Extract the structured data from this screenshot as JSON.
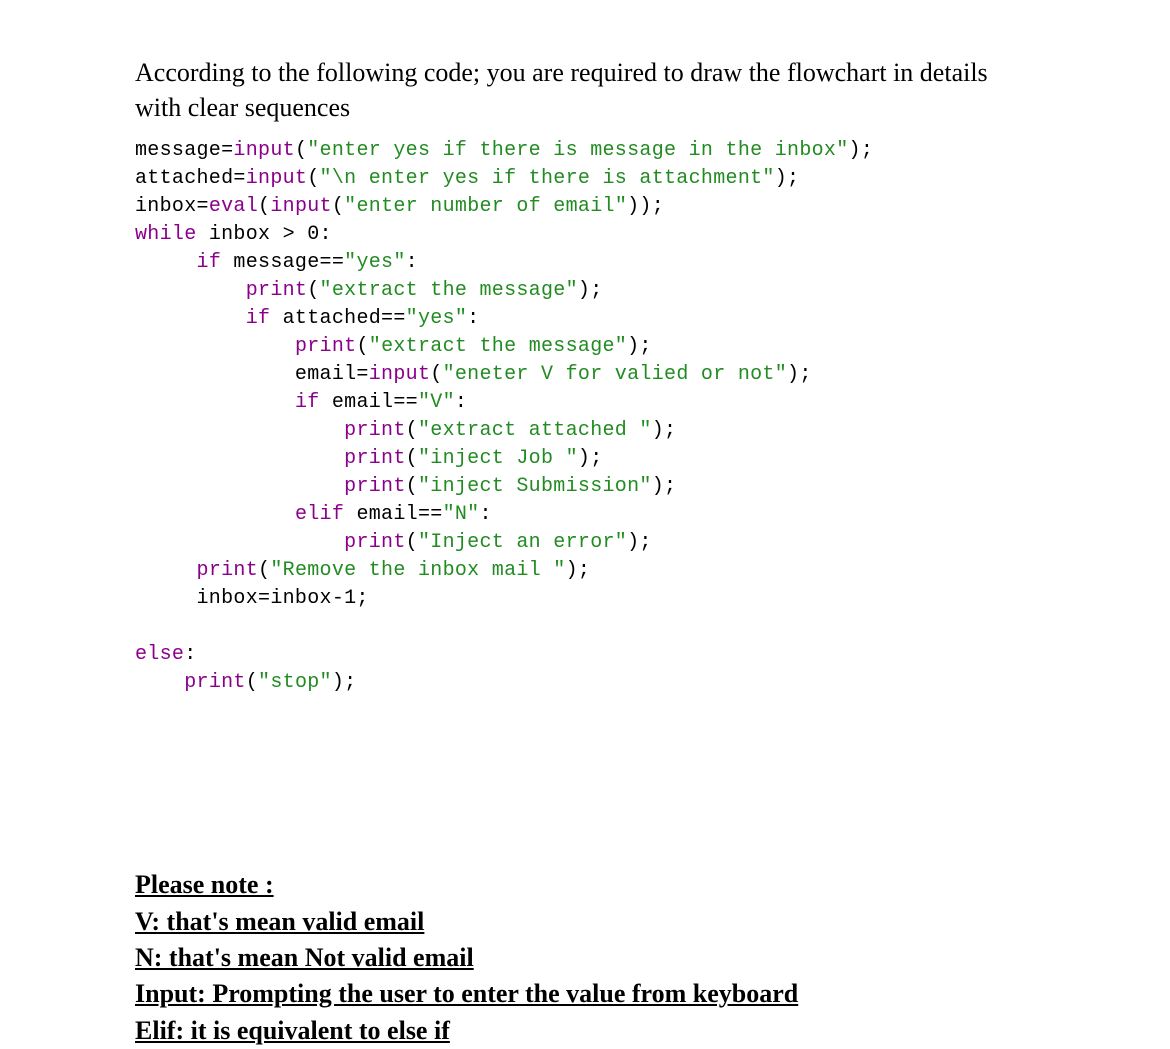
{
  "intro": "According to the following code; you are required to draw the flowchart in details with clear sequences",
  "code": {
    "l01_a": "message=",
    "l01_b": "input",
    "l01_c": "(",
    "l01_d": "\"enter yes if there is message in the inbox\"",
    "l01_e": ");",
    "l02_a": "attached=",
    "l02_b": "input",
    "l02_c": "(",
    "l02_d": "\"\\n enter yes if there is attachment\"",
    "l02_e": ");",
    "l03_a": "inbox=",
    "l03_b": "eval",
    "l03_c": "(",
    "l03_d": "input",
    "l03_e": "(",
    "l03_f": "\"enter number of email\"",
    "l03_g": "));",
    "l04_a": "while",
    "l04_b": " inbox > 0:",
    "l05_a": "     ",
    "l05_b": "if",
    "l05_c": " message==",
    "l05_d": "\"yes\"",
    "l05_e": ":",
    "l06_a": "         ",
    "l06_b": "print",
    "l06_c": "(",
    "l06_d": "\"extract the message\"",
    "l06_e": ");",
    "l07_a": "         ",
    "l07_b": "if",
    "l07_c": " attached==",
    "l07_d": "\"yes\"",
    "l07_e": ":",
    "l08_a": "             ",
    "l08_b": "print",
    "l08_c": "(",
    "l08_d": "\"extract the message\"",
    "l08_e": ");",
    "l09_a": "             email=",
    "l09_b": "input",
    "l09_c": "(",
    "l09_d": "\"eneter V for valied or not\"",
    "l09_e": ");",
    "l10_a": "             ",
    "l10_b": "if",
    "l10_c": " email==",
    "l10_d": "\"V\"",
    "l10_e": ":",
    "l11_a": "                 ",
    "l11_b": "print",
    "l11_c": "(",
    "l11_d": "\"extract attached \"",
    "l11_e": ");",
    "l12_a": "                 ",
    "l12_b": "print",
    "l12_c": "(",
    "l12_d": "\"inject Job \"",
    "l12_e": ");",
    "l13_a": "                 ",
    "l13_b": "print",
    "l13_c": "(",
    "l13_d": "\"inject Submission\"",
    "l13_e": ");",
    "l14_a": "             ",
    "l14_b": "elif",
    "l14_c": " email==",
    "l14_d": "\"N\"",
    "l14_e": ":",
    "l15_a": "                 ",
    "l15_b": "print",
    "l15_c": "(",
    "l15_d": "\"Inject an error\"",
    "l15_e": ");",
    "l16_a": "     ",
    "l16_b": "print",
    "l16_c": "(",
    "l16_d": "\"Remove the inbox mail \"",
    "l16_e": ");",
    "l17_a": "     inbox=inbox-1;",
    "l18_a": "",
    "l19_a": "else",
    "l19_b": ":",
    "l20_a": "    ",
    "l20_b": "print",
    "l20_c": "(",
    "l20_d": "\"stop\"",
    "l20_e": ");"
  },
  "notes": {
    "l1": "Please note :",
    "l2": "V: that's mean valid email",
    "l3": "N: that's mean Not valid email",
    "l4": "Input: Prompting the user to enter the value from keyboard",
    "l5": "Elif: it is equivalent to else if"
  }
}
